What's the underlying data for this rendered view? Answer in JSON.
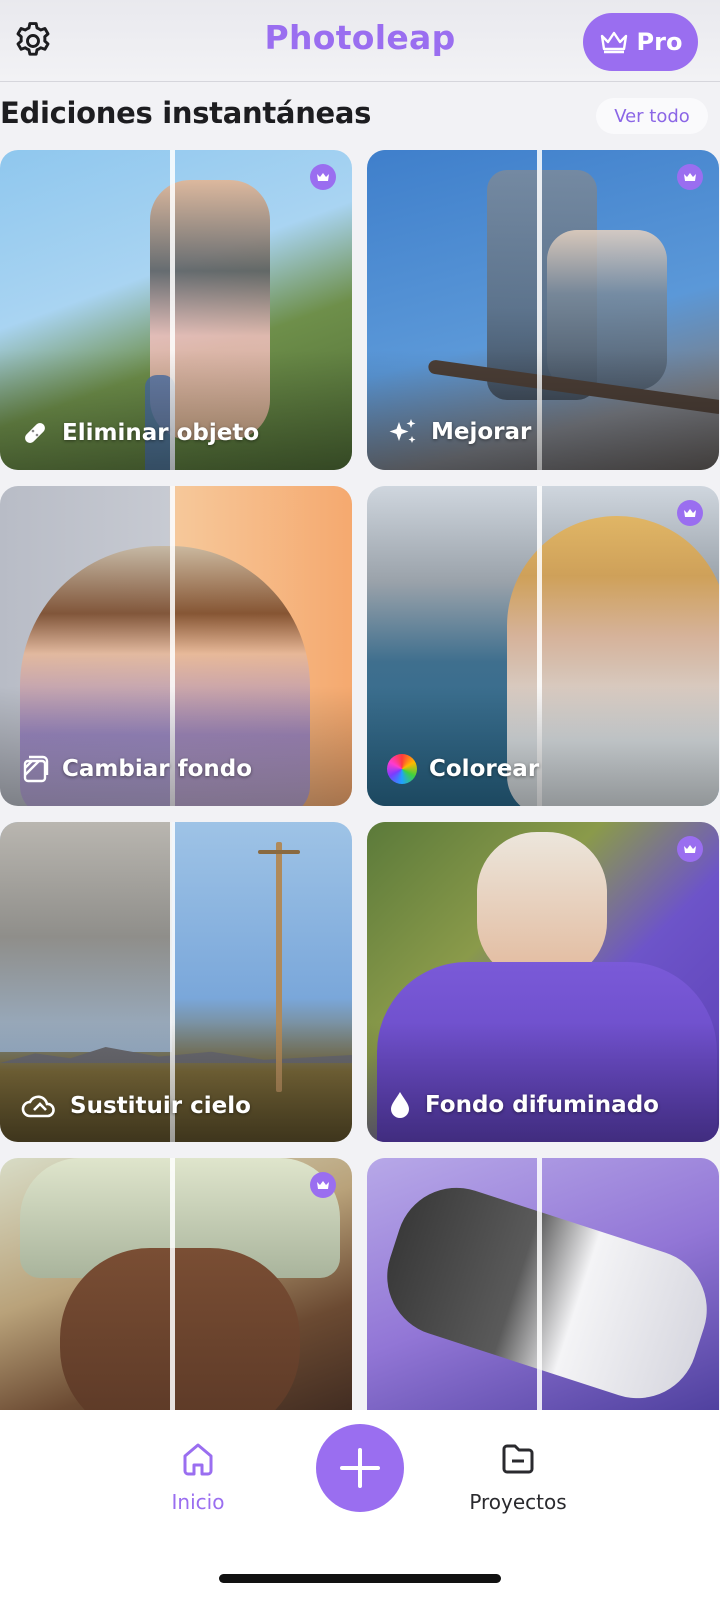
{
  "header": {
    "title": "Photoleap",
    "pro_label": "Pro"
  },
  "section": {
    "title": "Ediciones instantáneas",
    "see_all": "Ver todo"
  },
  "cards": [
    {
      "label": "Eliminar objeto",
      "icon": "bandage-icon",
      "pro": true
    },
    {
      "label": "Mejorar",
      "icon": "sparkles-icon",
      "pro": true
    },
    {
      "label": "Cambiar fondo",
      "icon": "background-icon",
      "pro": false
    },
    {
      "label": "Colorear",
      "icon": "color-wheel-icon",
      "pro": true
    },
    {
      "label": "Sustituir cielo",
      "icon": "cloud-icon",
      "pro": false
    },
    {
      "label": "Fondo difuminado",
      "icon": "drop-icon",
      "pro": true
    },
    {
      "label": "",
      "icon": "",
      "pro": true
    },
    {
      "label": "",
      "icon": "",
      "pro": false
    }
  ],
  "nav": {
    "home": "Inicio",
    "projects": "Proyectos"
  },
  "colors": {
    "accent": "#9a6ef0"
  }
}
